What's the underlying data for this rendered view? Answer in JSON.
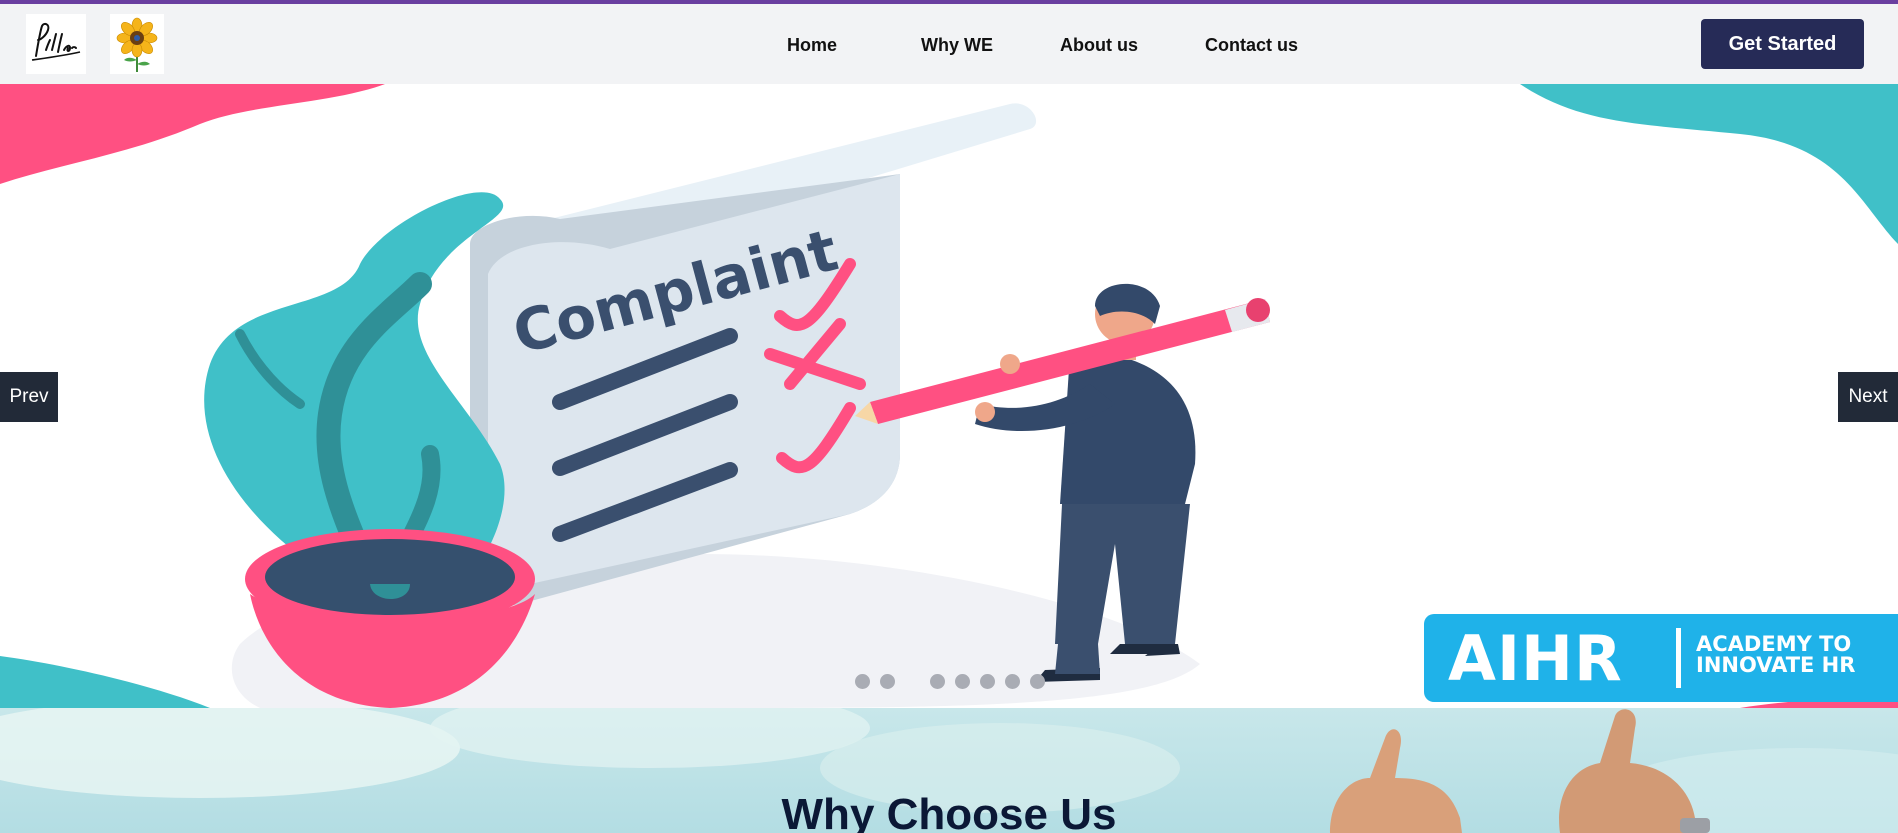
{
  "navbar": {
    "links": [
      "Home",
      "Why WE",
      "About us",
      "Contact us"
    ],
    "cta_label": "Get Started"
  },
  "hero": {
    "scroll_text": "Complaint",
    "prev_label": "Prev",
    "next_label": "Next",
    "slide_count": 7,
    "badge": {
      "main": "AIHR",
      "sub": "ACADEMY TO\nINNOVATE HR"
    }
  },
  "why": {
    "title": "Why Choose Us"
  },
  "colors": {
    "accent_stripe": "#6a3fa0",
    "button_navy": "#262b57",
    "pink": "#ff4f81",
    "teal": "#3fc1c9",
    "slate": "#3a4f6e",
    "badge_blue": "#1fb2e9"
  }
}
